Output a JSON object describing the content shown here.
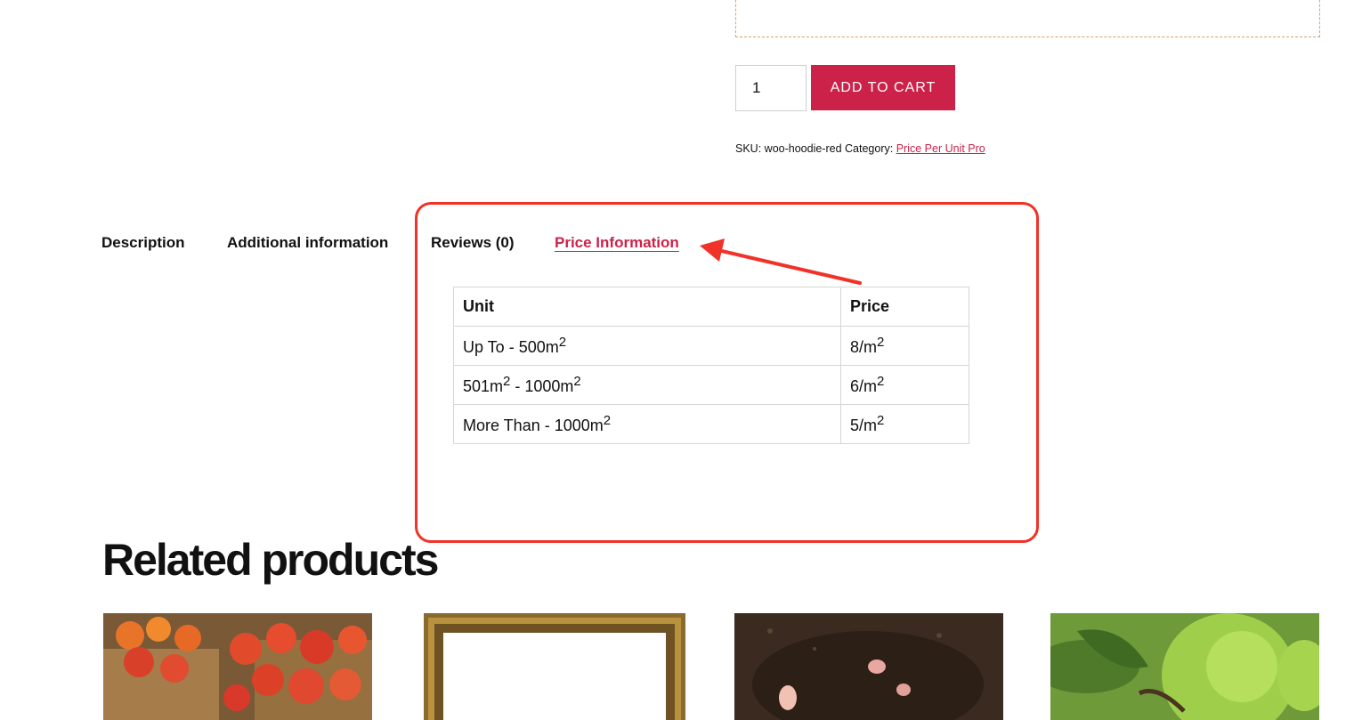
{
  "product": {
    "quantity": "1",
    "add_to_cart_label": "ADD TO CART",
    "sku_label": "SKU:",
    "sku_value": "woo-hoodie-red",
    "category_label": "Category:",
    "category_link": "Price Per Unit Pro"
  },
  "tabs": [
    {
      "label": "Description",
      "active": false
    },
    {
      "label": "Additional information",
      "active": false
    },
    {
      "label": "Reviews (0)",
      "active": false
    },
    {
      "label": "Price Information",
      "active": true
    }
  ],
  "price_table": {
    "headers": [
      "Unit",
      "Price"
    ],
    "rows": [
      {
        "unit_pre": "Up To - 500m",
        "unit_sup": "2",
        "unit_mid": "",
        "unit_sup2": "",
        "price_pre": "8/m",
        "price_sup": "2"
      },
      {
        "unit_pre": "501m",
        "unit_sup": "2",
        "unit_mid": " - 1000m",
        "unit_sup2": "2",
        "price_pre": "6/m",
        "price_sup": "2"
      },
      {
        "unit_pre": "More Than - 1000m",
        "unit_sup": "2",
        "unit_mid": "",
        "unit_sup2": "",
        "price_pre": "5/m",
        "price_sup": "2"
      }
    ]
  },
  "related": {
    "title": "Related products",
    "items": [
      {
        "image": "tomatoes-in-baskets"
      },
      {
        "image": "gold-picture-frame"
      },
      {
        "image": "soil-with-seeds"
      },
      {
        "image": "green-guava-fruit"
      }
    ]
  },
  "colors": {
    "accent": "#cc2249",
    "annotation": "#f03228"
  }
}
